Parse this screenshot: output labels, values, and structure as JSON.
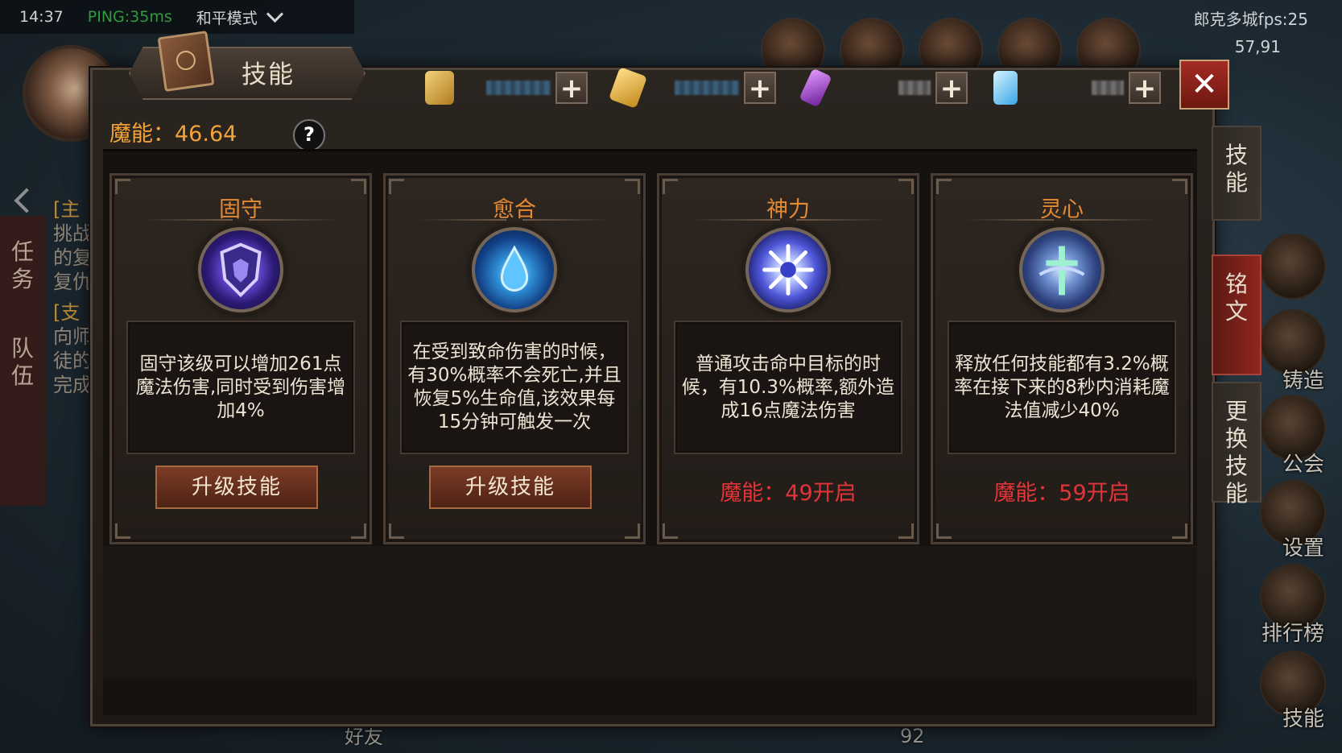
{
  "hud": {
    "time": "14:37",
    "ping": "PING:35ms",
    "mode": "和平模式",
    "fps": "郎克多城fps:25",
    "coords": "57,91",
    "left_tabs": [
      "任务",
      "队伍"
    ],
    "quests": [
      {
        "tag": "[主",
        "lines": [
          "挑战",
          "的复",
          "复仇"
        ]
      },
      {
        "tag": "[支",
        "lines": [
          "向师",
          "徒的",
          "完成"
        ]
      }
    ],
    "right_labels": [
      "铸造",
      "公会",
      "设置",
      "排行榜",
      "技能"
    ],
    "bottom": {
      "friends": "好友",
      "number": "92"
    }
  },
  "panel": {
    "title": "技能",
    "close_label": "✕",
    "mana_label": "魔能：46.64",
    "help_label": "?",
    "resources": [
      {
        "icon": "gold-bar-icon",
        "color": "#e0b040"
      },
      {
        "icon": "gold-feather-icon",
        "color": "#f2c04a"
      },
      {
        "icon": "purple-crystal-icon",
        "color": "#b347e0"
      },
      {
        "icon": "blue-crystal-icon",
        "color": "#7fd2ff"
      }
    ],
    "plus_label": "+"
  },
  "skills": [
    {
      "name": "固守",
      "icon": "shield-skill-icon",
      "desc": "固守该级可以增加261点魔法伤害,同时受到伤害增加4%",
      "action": "升级技能",
      "unlock": null
    },
    {
      "name": "愈合",
      "icon": "water-drop-skill-icon",
      "desc": "在受到致命伤害的时候，有30%概率不会死亡,并且恢复5%生命值,该效果每15分钟可触发一次",
      "action": "升级技能",
      "unlock": null
    },
    {
      "name": "神力",
      "icon": "burst-skill-icon",
      "desc": "普通攻击命中目标的时候，有10.3%概率,额外造成16点魔法伤害",
      "action": null,
      "unlock": "魔能：49开启"
    },
    {
      "name": "灵心",
      "icon": "cross-skill-icon",
      "desc": "释放任何技能都有3.2%概率在接下来的8秒内消耗魔法值减少40%",
      "action": null,
      "unlock": "魔能：59开启"
    }
  ],
  "side_tabs": [
    {
      "label": "技能",
      "active": false
    },
    {
      "label": "铭文",
      "active": true
    },
    {
      "label": "更换技能",
      "active": false
    }
  ]
}
